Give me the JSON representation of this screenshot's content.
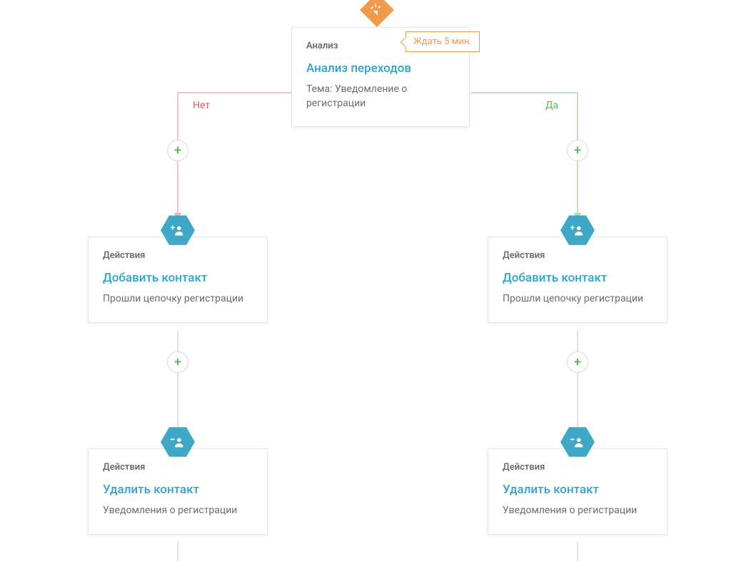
{
  "root": {
    "wait_label": "Ждать 5 мин.",
    "category": "Анализ",
    "title": "Анализ переходов",
    "subject": "Тема: Уведомление о регистрации",
    "icon": "click-cursor-icon"
  },
  "branches": {
    "no_label": "Нет",
    "yes_label": "Да"
  },
  "left": {
    "add": {
      "category": "Действия",
      "title": "Добавить контакт",
      "sub": "Прошли цепочку регистрации",
      "icon": "add-user-icon"
    },
    "remove": {
      "category": "Действия",
      "title": "Удалить контакт",
      "sub": "Уведомления о регистрации",
      "icon": "remove-user-icon"
    }
  },
  "right": {
    "add": {
      "category": "Действия",
      "title": "Добавить контакт",
      "sub": "Прошли цепочку регистрации",
      "icon": "add-user-icon"
    },
    "remove": {
      "category": "Действия",
      "title": "Удалить контакт",
      "sub": "Уведомления о регистрации",
      "icon": "remove-user-icon"
    }
  },
  "colors": {
    "teal": "#2fa4cc",
    "orange": "#f2994a",
    "green": "#5db85c",
    "red": "#e05858",
    "hex_teal": "#3fa8c6",
    "hex_orange": "#f2994a"
  }
}
